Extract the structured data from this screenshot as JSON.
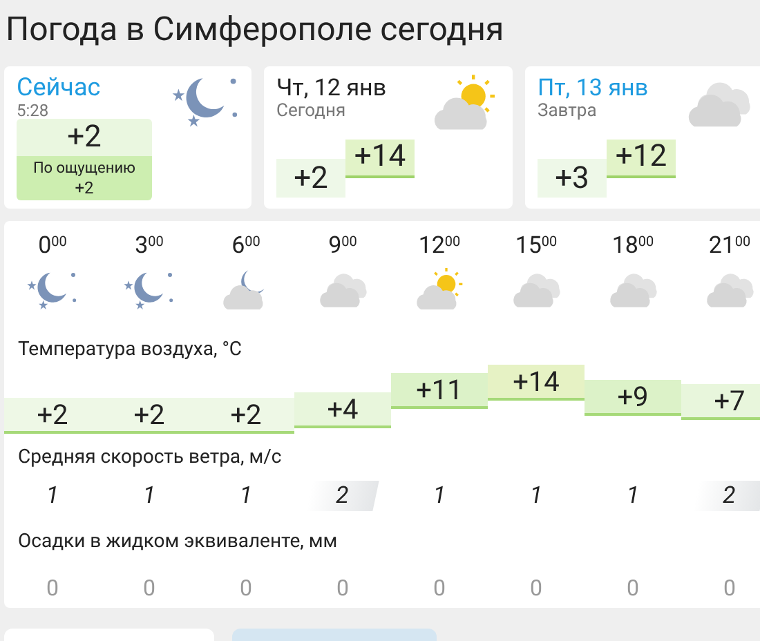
{
  "title": "Погода в Симферополе сегодня",
  "now": {
    "label": "Сейчас",
    "time": "5:28",
    "temp": "+2",
    "feels_label": "По ощущению",
    "feels": "+2",
    "kind": "night"
  },
  "days": [
    {
      "title": "Чт, 12 янв",
      "subtitle": "Сегодня",
      "selected": false,
      "min": "+2",
      "max": "+14",
      "kind": "sun-cloud"
    },
    {
      "title": "Пт, 13 янв",
      "subtitle": "Завтра",
      "selected": true,
      "min": "+3",
      "max": "+12",
      "kind": "cloud"
    }
  ],
  "hours": [
    {
      "hour": "0",
      "minutes": "00",
      "kind": "night"
    },
    {
      "hour": "3",
      "minutes": "00",
      "kind": "night"
    },
    {
      "hour": "6",
      "minutes": "00",
      "kind": "moon-cloud"
    },
    {
      "hour": "9",
      "minutes": "00",
      "kind": "cloud"
    },
    {
      "hour": "12",
      "minutes": "00",
      "kind": "sun-cloud"
    },
    {
      "hour": "15",
      "minutes": "00",
      "kind": "cloud"
    },
    {
      "hour": "18",
      "minutes": "00",
      "kind": "cloud"
    },
    {
      "hour": "21",
      "minutes": "00",
      "kind": "cloud"
    }
  ],
  "temperature": {
    "label": "Температура воздуха, °C",
    "values": [
      {
        "text": "+2"
      },
      {
        "text": "+2"
      },
      {
        "text": "+2"
      },
      {
        "text": "+4"
      },
      {
        "text": "+11"
      },
      {
        "text": "+14"
      },
      {
        "text": "+9"
      },
      {
        "text": "+7"
      }
    ]
  },
  "wind": {
    "label": "Средняя скорость ветра, м/с",
    "values": [
      {
        "text": "1",
        "highlighted": false
      },
      {
        "text": "1",
        "highlighted": false
      },
      {
        "text": "1",
        "highlighted": false
      },
      {
        "text": "2",
        "highlighted": true
      },
      {
        "text": "1",
        "highlighted": false
      },
      {
        "text": "1",
        "highlighted": false
      },
      {
        "text": "1",
        "highlighted": false
      },
      {
        "text": "2",
        "highlighted": true
      }
    ]
  },
  "precipitation": {
    "label": "Осадки в жидком эквиваленте, мм",
    "values": [
      "0",
      "0",
      "0",
      "0",
      "0",
      "0",
      "0",
      "0"
    ]
  }
}
